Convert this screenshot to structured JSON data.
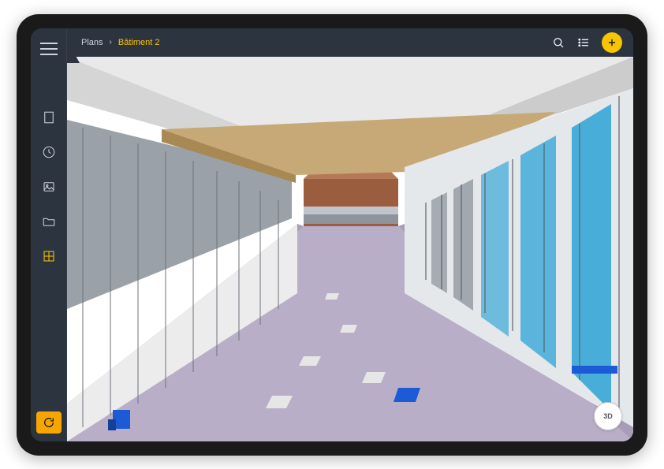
{
  "breadcrumb": {
    "root": "Plans",
    "separator": "›",
    "current": "Bâtiment 2"
  },
  "rail": {
    "items": [
      {
        "name": "building",
        "active": false
      },
      {
        "name": "clock",
        "active": false
      },
      {
        "name": "image",
        "active": false
      },
      {
        "name": "folder",
        "active": false
      },
      {
        "name": "layout",
        "active": true
      }
    ]
  },
  "buttons": {
    "mode3d_label": "3D"
  },
  "colors": {
    "accent": "#f7c600",
    "accent_orange": "#f7a600",
    "dark": "#2c3440",
    "floor": "#b9aec7",
    "wall_light": "#f2f2f2",
    "wall_grey": "#9aa1a8",
    "glass": "#2da3d6",
    "ceiling_wood": "#c7a978",
    "back_brown": "#9a5e3f",
    "marker_blue": "#1c5ad6"
  }
}
